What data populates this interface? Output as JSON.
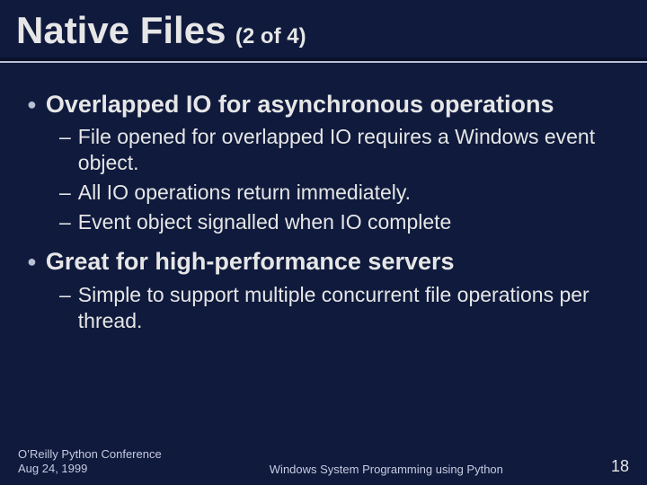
{
  "title": {
    "main": "Native Files",
    "sub": "(2 of 4)"
  },
  "bullets": [
    {
      "text": "Overlapped IO for asynchronous operations",
      "sub": [
        "File opened for overlapped IO requires a Windows event object.",
        "All IO operations return immediately.",
        "Event object signalled when IO complete"
      ]
    },
    {
      "text": "Great for high-performance servers",
      "sub": [
        "Simple to support multiple concurrent file operations per thread."
      ]
    }
  ],
  "footer": {
    "left_line1": "O’Reilly Python Conference",
    "left_line2": "Aug 24, 1999",
    "center": "Windows System Programming using Python",
    "page": "18"
  }
}
